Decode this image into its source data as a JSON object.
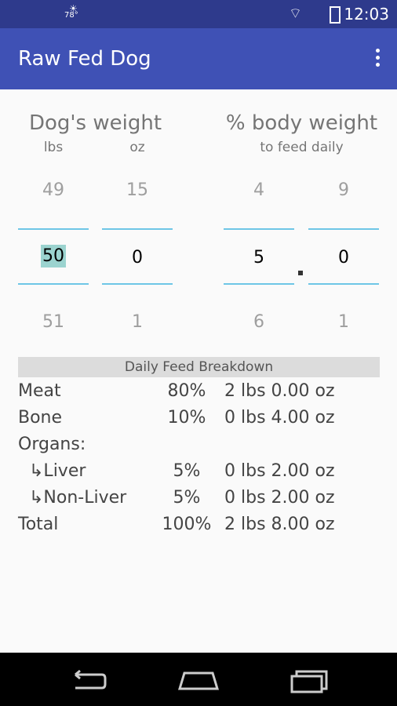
{
  "status": {
    "time": "12:03",
    "temp": "78°"
  },
  "app": {
    "title": "Raw Fed Dog"
  },
  "weight": {
    "title": "Dog's weight",
    "lbs_label": "lbs",
    "oz_label": "oz",
    "lbs_prev": "49",
    "lbs": "50",
    "lbs_next": "51",
    "oz_prev": "15",
    "oz": "0",
    "oz_next": "1"
  },
  "bodyweight": {
    "title": "% body weight",
    "subtitle": "to feed daily",
    "int_prev": "4",
    "int": "5",
    "int_next": "6",
    "dec_prev": "9",
    "dec": "0",
    "dec_next": "1"
  },
  "breakdown": {
    "title": "Daily Feed Breakdown",
    "rows": [
      {
        "name": "Meat",
        "pct": "80%",
        "amt": "2 lbs 0.00 oz"
      },
      {
        "name": "Bone",
        "pct": "10%",
        "amt": "0 lbs 4.00 oz"
      },
      {
        "name": "Organs:",
        "pct": "",
        "amt": ""
      },
      {
        "name": "↳Liver",
        "pct": "5%",
        "amt": "0 lbs 2.00 oz"
      },
      {
        "name": "↳Non-Liver",
        "pct": "5%",
        "amt": "0 lbs 2.00 oz"
      },
      {
        "name": "Total",
        "pct": "100%",
        "amt": "2 lbs 8.00 oz"
      }
    ]
  }
}
